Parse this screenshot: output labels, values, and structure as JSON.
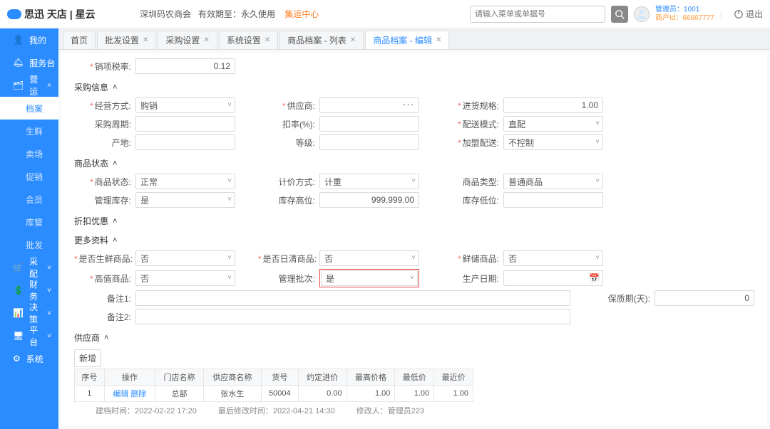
{
  "top": {
    "brand": "思迅 天店 | 星云",
    "company": "深圳码农商会",
    "valid_label": "有效期至：",
    "valid_value": "永久使用",
    "center": "集运中心",
    "search_placeholder": "请输入菜单或单据号",
    "user_role": "管理员：",
    "user_id": "1001",
    "account_label": "商户Id：",
    "account_id": "66667777",
    "logout": "退出"
  },
  "sidebar": {
    "items": [
      {
        "label": "我的",
        "sub": false
      },
      {
        "label": "服务台",
        "sub": false
      },
      {
        "label": "营运",
        "sub": false,
        "expand": true
      },
      {
        "label": "档案",
        "sub": true,
        "active": true
      },
      {
        "label": "生鲜",
        "sub": true
      },
      {
        "label": "卖场",
        "sub": true
      },
      {
        "label": "促销",
        "sub": true
      },
      {
        "label": "会员",
        "sub": true
      },
      {
        "label": "库管",
        "sub": true
      },
      {
        "label": "批发",
        "sub": true
      },
      {
        "label": "采配",
        "sub": false,
        "expand": false
      },
      {
        "label": "财务",
        "sub": false,
        "expand": false
      },
      {
        "label": "决策",
        "sub": false,
        "expand": false
      },
      {
        "label": "平台",
        "sub": false,
        "expand": false
      },
      {
        "label": "系统",
        "sub": false
      }
    ]
  },
  "tabs": [
    {
      "label": "首页",
      "closable": false
    },
    {
      "label": "批发设置",
      "closable": true
    },
    {
      "label": "采购设置",
      "closable": true
    },
    {
      "label": "系统设置",
      "closable": true
    },
    {
      "label": "商品档案 - 列表",
      "closable": true
    },
    {
      "label": "商品档案 - 编辑",
      "closable": true,
      "active": true
    }
  ],
  "top_field": {
    "label": "销项税率:",
    "value": "0.12"
  },
  "sections": {
    "purchase": "采购信息",
    "status": "商品状态",
    "discount": "折扣优惠",
    "more": "更多资料",
    "supplier": "供应商"
  },
  "fields": {
    "jyfs": {
      "label": "经营方式:",
      "value": "购销",
      "req": true
    },
    "cgzq": {
      "label": "采购周期:",
      "value": ""
    },
    "cd": {
      "label": "产地:",
      "value": ""
    },
    "gys": {
      "label": "供应商:",
      "value": "",
      "req": true
    },
    "kl": {
      "label": "扣率(%):",
      "value": ""
    },
    "dj": {
      "label": "等级:",
      "value": ""
    },
    "jhgg": {
      "label": "进货规格:",
      "value": "1.00",
      "req": true
    },
    "psms": {
      "label": "配送模式:",
      "value": "直配",
      "req": true
    },
    "jmps": {
      "label": "加盟配送:",
      "value": "不控制",
      "req": true
    },
    "spzt": {
      "label": "商品状态:",
      "value": "正常",
      "req": true
    },
    "glkc": {
      "label": "管理库存:",
      "value": "是"
    },
    "jjfs": {
      "label": "计价方式:",
      "value": "计重"
    },
    "kcgw": {
      "label": "库存高位:",
      "value": "999,999.00"
    },
    "splx": {
      "label": "商品类型:",
      "value": "普通商品"
    },
    "kcdw": {
      "label": "库存低位:",
      "value": ""
    },
    "sfsx": {
      "label": "是否生鲜商品:",
      "value": "否"
    },
    "gzsp": {
      "label": "高值商品:",
      "value": "否"
    },
    "sfrq": {
      "label": "是否日清商品:",
      "value": "否"
    },
    "glpc": {
      "label": "管理批次:",
      "value": "是"
    },
    "xcsp": {
      "label": "鲜储商品:",
      "value": "否"
    },
    "scrq": {
      "label": "生产日期:",
      "value": ""
    },
    "bz1": {
      "label": "备注1:",
      "value": ""
    },
    "bz2": {
      "label": "备注2:",
      "value": ""
    },
    "bzts": {
      "label": "保质期(天):",
      "value": "0"
    }
  },
  "table": {
    "add": "新增",
    "headers": [
      "序号",
      "操作",
      "门店名称",
      "供应商名称",
      "货号",
      "约定进价",
      "最高价格",
      "最低价",
      "最近价"
    ],
    "row": {
      "seq": "1",
      "ops_edit": "编辑",
      "ops_del": "删除",
      "store": "总部",
      "supplier": "张水生",
      "code": "50004",
      "price1": "0.00",
      "price2": "1.00",
      "price3": "1.00",
      "price4": "1.00"
    }
  },
  "footer": {
    "create_label": "建档时间：",
    "create_val": "2022-02-22 17:20",
    "mod_label": "最后修改时间：",
    "mod_val": "2022-04-21 14:30",
    "modby_label": "修改人：",
    "modby_val": "管理员223"
  }
}
